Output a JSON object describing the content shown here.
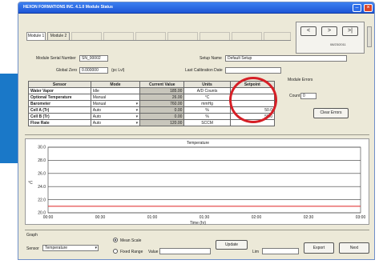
{
  "window": {
    "title": "HEXON FORMATIONS INC. 4.1.0 Module Status"
  },
  "tabs": [
    "Module 1",
    "Module 2"
  ],
  "ghost_tab_count": 7,
  "nav": {
    "buttons": [
      "<",
      ">",
      ">|"
    ],
    "date": "08/23/2011"
  },
  "info": {
    "serial_label": "Module Serial Number",
    "serial_value": "SN_00002",
    "zero_label": "Global Zero",
    "zero_value": "0.000000",
    "zero_unit": "(pc Lvl)",
    "setup_label": "Setup Name",
    "setup_value": "Default Setup",
    "cal_label": "Last Calibration Date"
  },
  "table": {
    "headers": [
      "Sensor",
      "Mode",
      "Current Value",
      "Units",
      "Setpoint"
    ],
    "rows": [
      {
        "sensor": "Water Vapor",
        "mode": "Idle",
        "dd": false,
        "value": "185.00",
        "units": "A/D Counts",
        "setpoint": ""
      },
      {
        "sensor": "Optional Temperature",
        "mode": "Manual",
        "dd": false,
        "value": "26.00",
        "units": "°C",
        "setpoint": ""
      },
      {
        "sensor": "Barometer",
        "mode": "Manual",
        "dd": true,
        "value": "760.00",
        "units": "mmHg",
        "setpoint": ""
      },
      {
        "sensor": "Cell A (Tr)",
        "mode": "Auto",
        "dd": true,
        "value": "0.00",
        "units": "%",
        "setpoint": "50.0"
      },
      {
        "sensor": "Cell B (Tr)",
        "mode": "Auto",
        "dd": true,
        "value": "0.00",
        "units": "%",
        "setpoint": "50.0"
      },
      {
        "sensor": "Flow Rate",
        "mode": "Auto",
        "dd": true,
        "value": "120.00",
        "units": "SCCM",
        "setpoint": ""
      }
    ]
  },
  "module_errors": {
    "title": "Module Errors",
    "count_label": "Count",
    "count_value": "0",
    "clear_label": "Clear Errors"
  },
  "chart_data": {
    "type": "line",
    "title": "Temperature",
    "xlabel": "Time (hr)",
    "ylabel": "°C",
    "x_ticks": [
      "00:00",
      "00:30",
      "01:00",
      "01:30",
      "02:00",
      "02:30",
      "03:00"
    ],
    "y_ticks": [
      "30.0",
      "28.0",
      "26.0",
      "24.0",
      "22.0",
      "20.0"
    ],
    "ylim": [
      20,
      30
    ],
    "grid": true,
    "series": [
      {
        "x": [
          "00:00",
          "03:00"
        ],
        "values": [
          21.0,
          21.0
        ],
        "color": "#e23b3b"
      }
    ]
  },
  "controls": {
    "graph_label": "Graph",
    "sensor_label": "Sensor",
    "sensor_value": "Temperature",
    "radio_1": "Mean Scale",
    "radio_2": "Fixed Range",
    "value_label": "Value",
    "limit_label": "Lim",
    "update_label": "Update",
    "export_label": "Export",
    "next_label": "Next"
  },
  "colors": {
    "title_bar": "#1d56d6",
    "highlight": "#d61f26",
    "left_block": "#1a78c8",
    "series": "#e23b3b"
  }
}
